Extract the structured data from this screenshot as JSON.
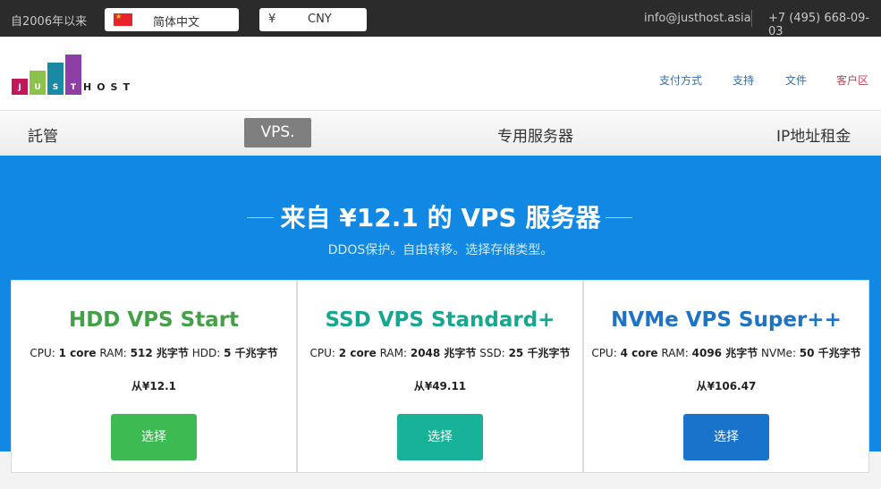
{
  "topbar": {
    "since": "自2006年以来",
    "language": "简体中文",
    "currency_symbol": "¥",
    "currency": "CNY",
    "email": "info@justhost.asia",
    "phone": "+7 (495) 668-09-03"
  },
  "logo": {
    "letters": [
      "J",
      "U",
      "S",
      "T"
    ],
    "host": "HOST"
  },
  "header_nav": {
    "payment": "支付方式",
    "support": "支持",
    "docs": "文件",
    "client_area": "客户区"
  },
  "main_nav": {
    "hosting": "託管",
    "vps": "VPS.",
    "dedicated": "专用服务器",
    "ip_rent": "IP地址租金"
  },
  "hero": {
    "title": "来自 ¥12.1 的 VPS 服务器",
    "subtitle": "DDOS保护。自由转移。选择存储类型。"
  },
  "plans": [
    {
      "title": "HDD VPS Start",
      "color": "#43a047",
      "cpu_label": "CPU: ",
      "cpu": "1 core",
      "ram_label": " RAM: ",
      "ram": "512 兆字节",
      "disk_label": " HDD: ",
      "disk": "5 千兆字节",
      "price": "从¥12.1",
      "button": "选择",
      "button_color": "#3dba52"
    },
    {
      "title": "SSD VPS Standard+",
      "color": "#17a68f",
      "cpu_label": "CPU: ",
      "cpu": "2 core",
      "ram_label": " RAM: ",
      "ram": "2048 兆字节",
      "disk_label": " SSD: ",
      "disk": "25 千兆字节",
      "price": "从¥49.11",
      "button": "选择",
      "button_color": "#17b298"
    },
    {
      "title": "NVMe VPS Super++",
      "color": "#1f73c4",
      "cpu_label": "CPU: ",
      "cpu": "4 core",
      "ram_label": " RAM: ",
      "ram": "4096 兆字节",
      "disk_label": " NVMe: ",
      "disk": "50 千兆字节",
      "price": "从¥106.47",
      "button": "选择",
      "button_color": "#1a73cb"
    }
  ],
  "colors": {
    "topbar": "#2b2b2b",
    "hero": "#1188e3",
    "nav_active": "#7f7f7f"
  }
}
